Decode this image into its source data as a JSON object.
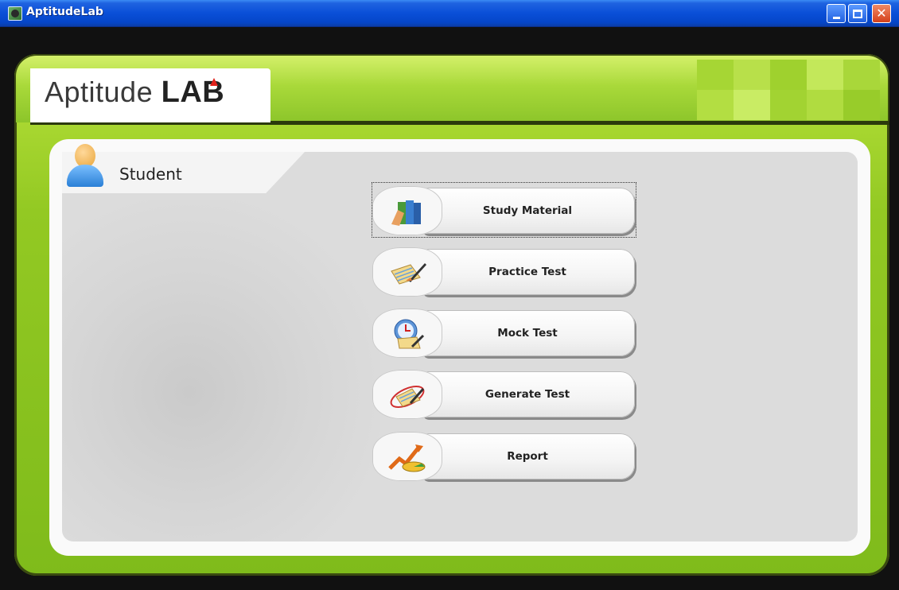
{
  "window": {
    "title": "AptitudeLab"
  },
  "logo": {
    "text_regular": "Aptitude ",
    "text_bold": "LAB"
  },
  "section": {
    "user_label": "Student"
  },
  "menu": [
    {
      "label": "Study Material",
      "icon": "books-icon"
    },
    {
      "label": "Practice Test",
      "icon": "pencil-paper-icon"
    },
    {
      "label": "Mock Test",
      "icon": "clock-paper-icon"
    },
    {
      "label": "Generate Test",
      "icon": "generate-paper-icon"
    },
    {
      "label": "Report",
      "icon": "chart-report-icon"
    }
  ],
  "colors": {
    "titlebar": "#0a4fd8",
    "frame_green": "#93c923",
    "panel_gray": "#dcdcdc",
    "logo_accent": "#e0211b"
  }
}
